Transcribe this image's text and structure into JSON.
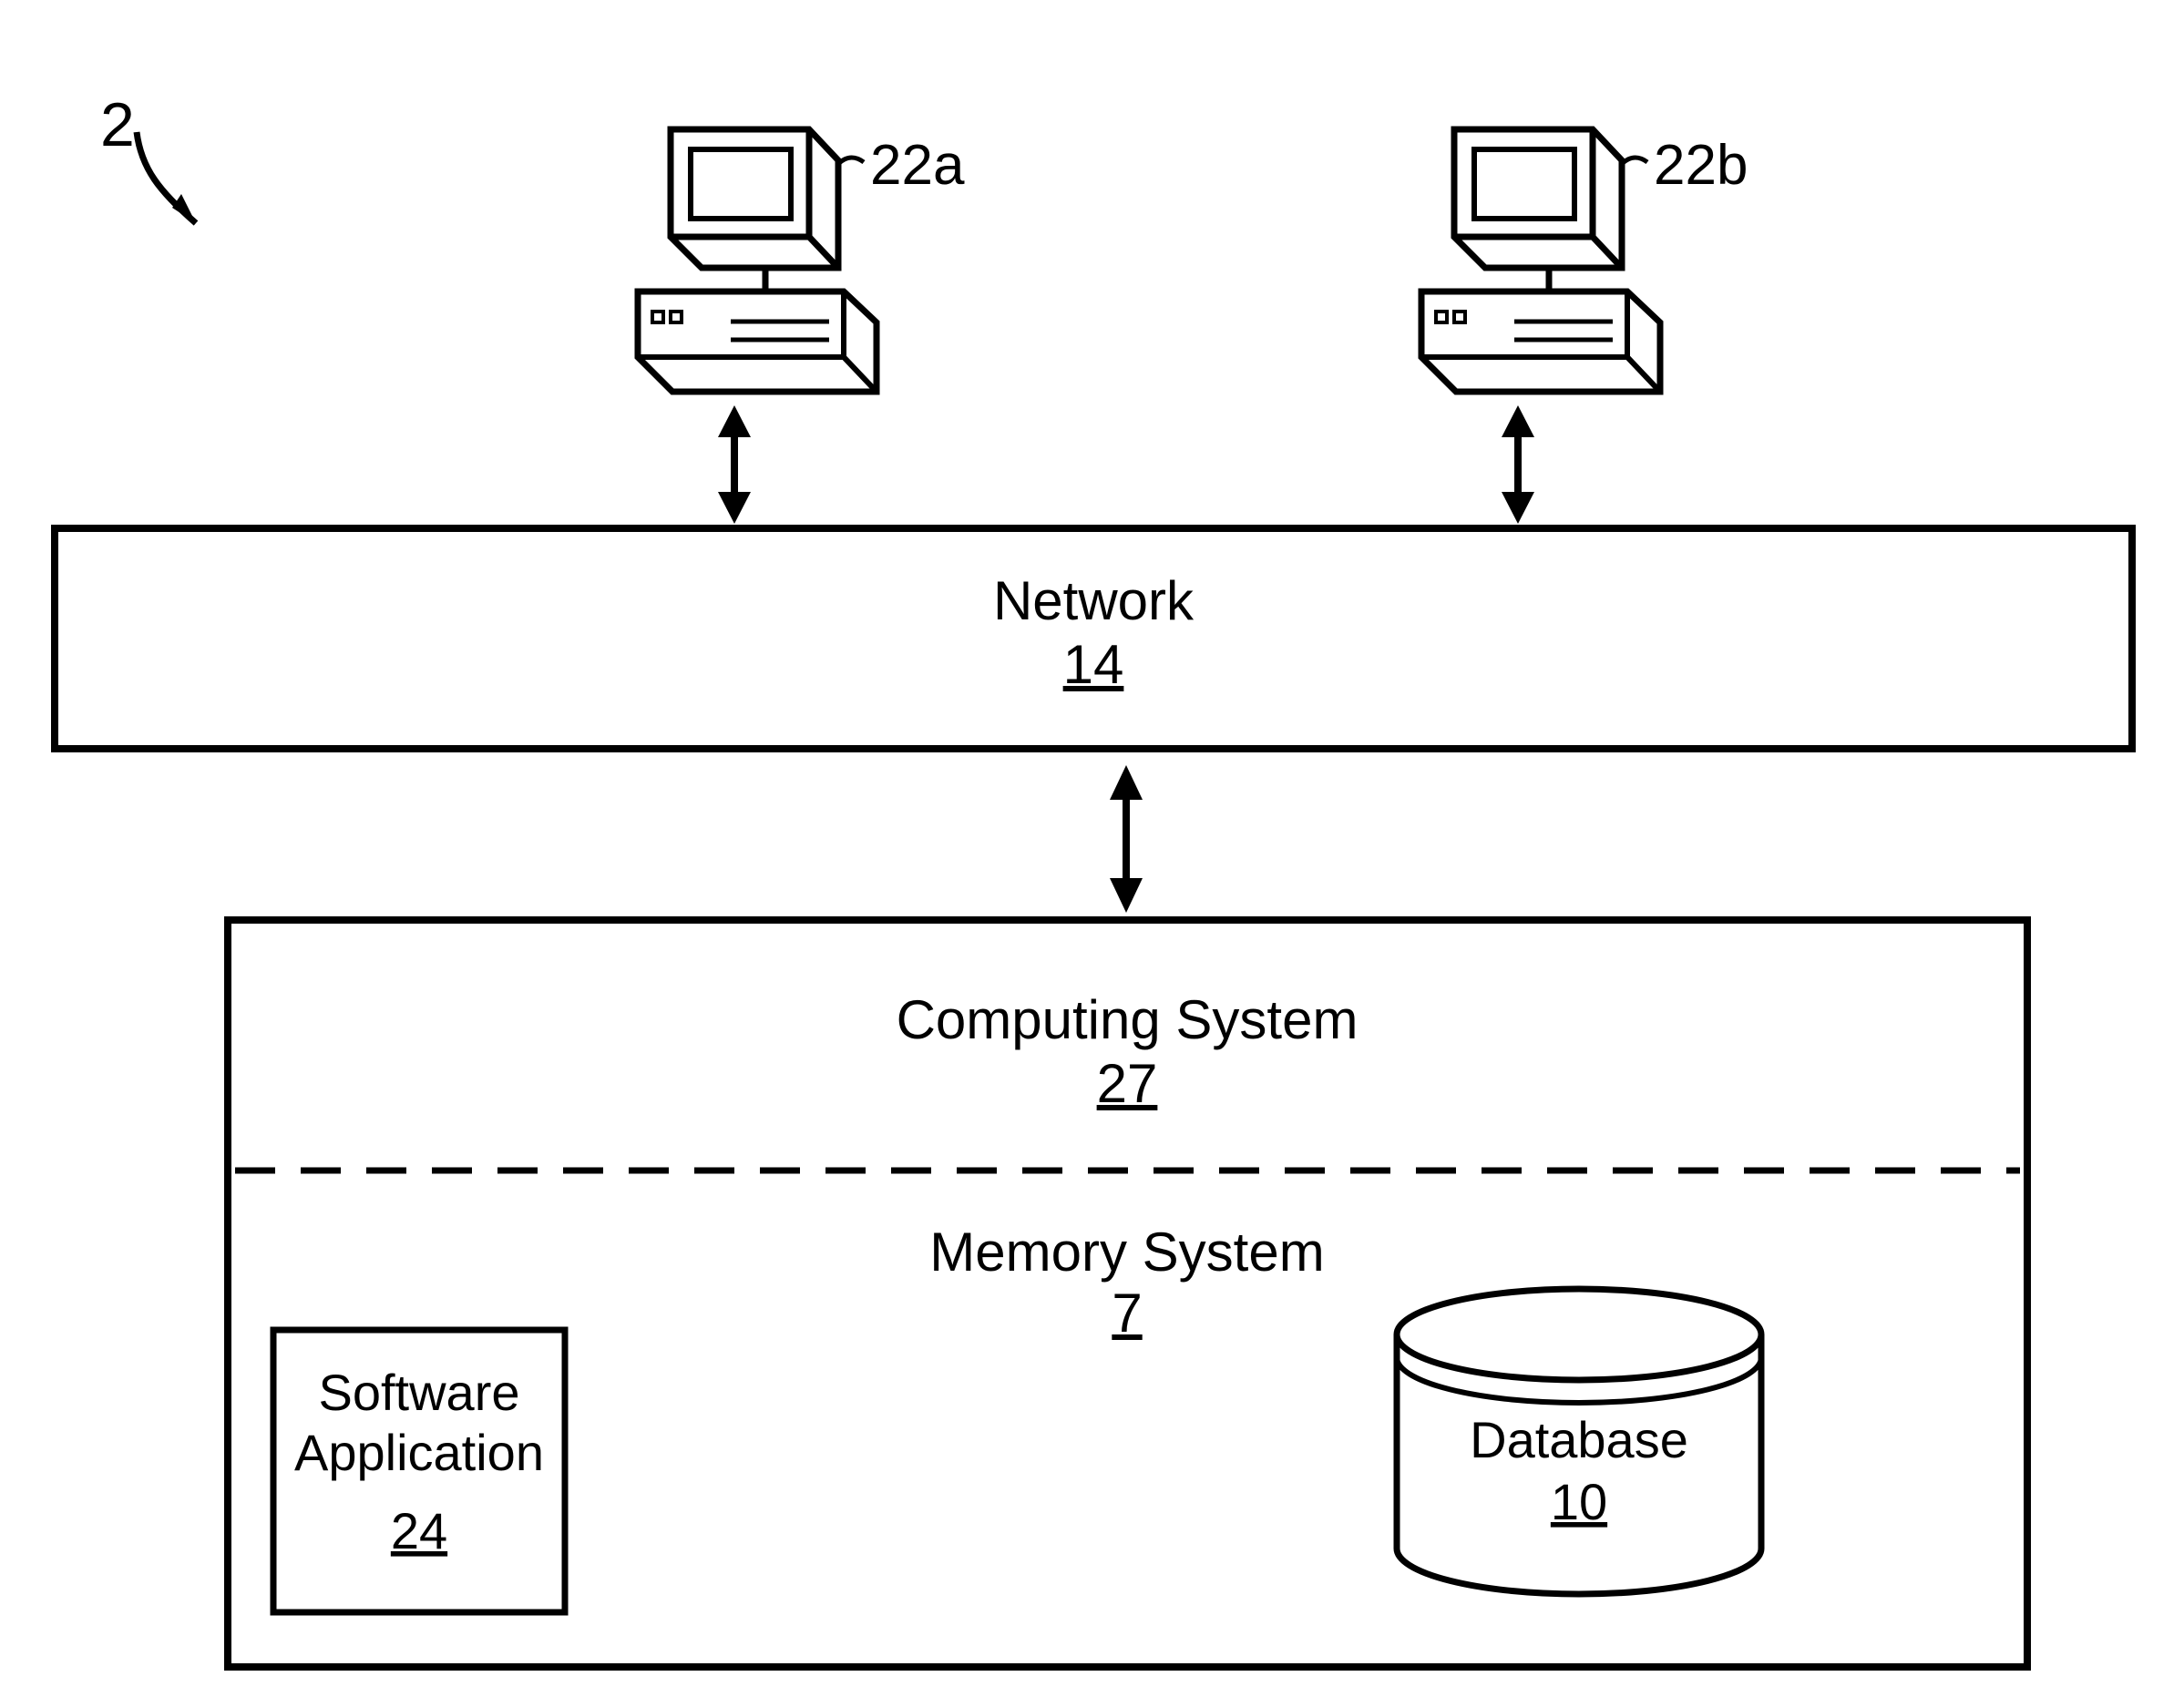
{
  "figure_ref": "2",
  "terminals": {
    "a": {
      "label": "22a"
    },
    "b": {
      "label": "22b"
    }
  },
  "network": {
    "title": "Network",
    "num": "14"
  },
  "computing_system": {
    "title": "Computing System",
    "num": "27"
  },
  "memory_system": {
    "title": "Memory System",
    "num": "7"
  },
  "software_app": {
    "title_line1": "Software",
    "title_line2": "Application",
    "num": "24"
  },
  "database": {
    "title": "Database",
    "num": "10"
  }
}
